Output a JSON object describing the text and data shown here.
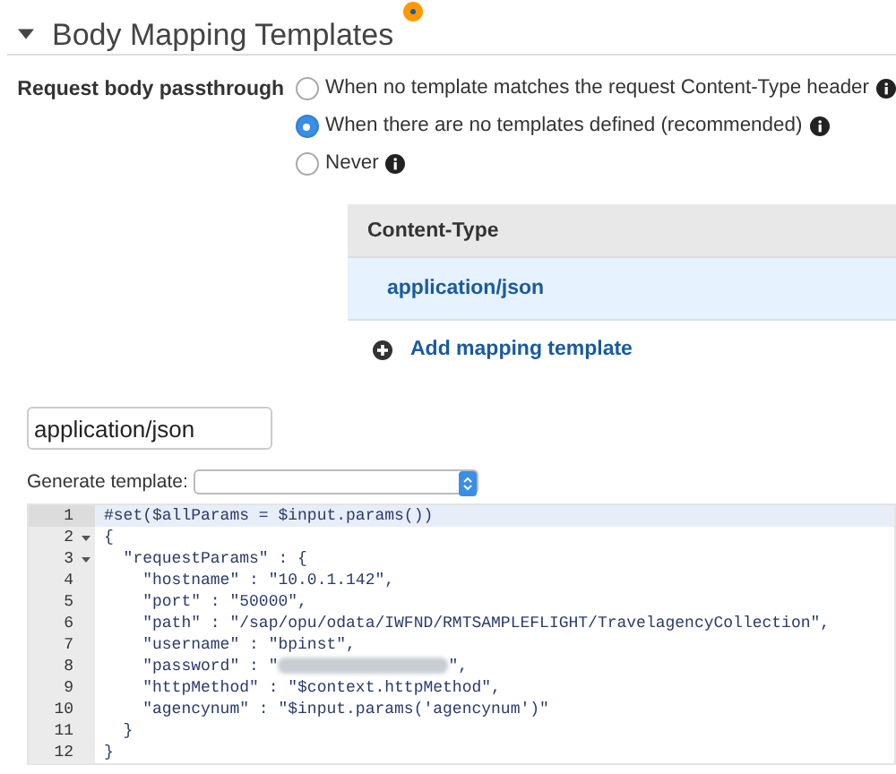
{
  "section": {
    "title": "Body Mapping Templates",
    "expanded": true,
    "changed": true
  },
  "passthrough": {
    "label": "Request body passthrough",
    "options": [
      {
        "label": "When no template matches the request Content-Type header",
        "selected": false,
        "info": true
      },
      {
        "label": "When there are no templates defined (recommended)",
        "selected": true,
        "info": true
      },
      {
        "label": "Never",
        "selected": false,
        "info": true
      }
    ]
  },
  "content_types": {
    "column": "Content-Type",
    "rows": [
      {
        "text": "application/json",
        "selected": true
      }
    ],
    "add_link": "Add mapping template"
  },
  "name_field": {
    "value": "application/json"
  },
  "generate": {
    "label": "Generate template:"
  },
  "editor": {
    "lines": [
      {
        "number": "1",
        "text": "#set($allParams = $input.params())",
        "fold": false,
        "highlighted": true
      },
      {
        "number": "2",
        "text": "{",
        "fold": true,
        "highlighted": false
      },
      {
        "number": "3",
        "text": "  \"requestParams\" : {",
        "fold": true,
        "highlighted": false
      },
      {
        "number": "4",
        "text": "    \"hostname\" : \"10.0.1.142\",",
        "fold": false,
        "highlighted": false
      },
      {
        "number": "5",
        "text": "    \"port\" : \"50000\",",
        "fold": false,
        "highlighted": false
      },
      {
        "number": "6",
        "text": "    \"path\" : \"/sap/opu/odata/IWFND/RMTSAMPLEFLIGHT/TravelagencyCollection\",",
        "fold": false,
        "highlighted": false
      },
      {
        "number": "7",
        "text": "    \"username\" : \"bpinst\",",
        "fold": false,
        "highlighted": false
      },
      {
        "number": "8",
        "text": "    \"password\" : \"",
        "redacted": true,
        "after": "\",",
        "fold": false,
        "highlighted": false
      },
      {
        "number": "9",
        "text": "    \"httpMethod\" : \"$context.httpMethod\",",
        "fold": false,
        "highlighted": false
      },
      {
        "number": "10",
        "text": "    \"agencynum\" : \"$input.params('agencynum')\"",
        "fold": false,
        "highlighted": false
      },
      {
        "number": "11",
        "text": "  }",
        "fold": false,
        "highlighted": false
      },
      {
        "number": "12",
        "text": "}",
        "fold": false,
        "highlighted": false
      }
    ]
  }
}
